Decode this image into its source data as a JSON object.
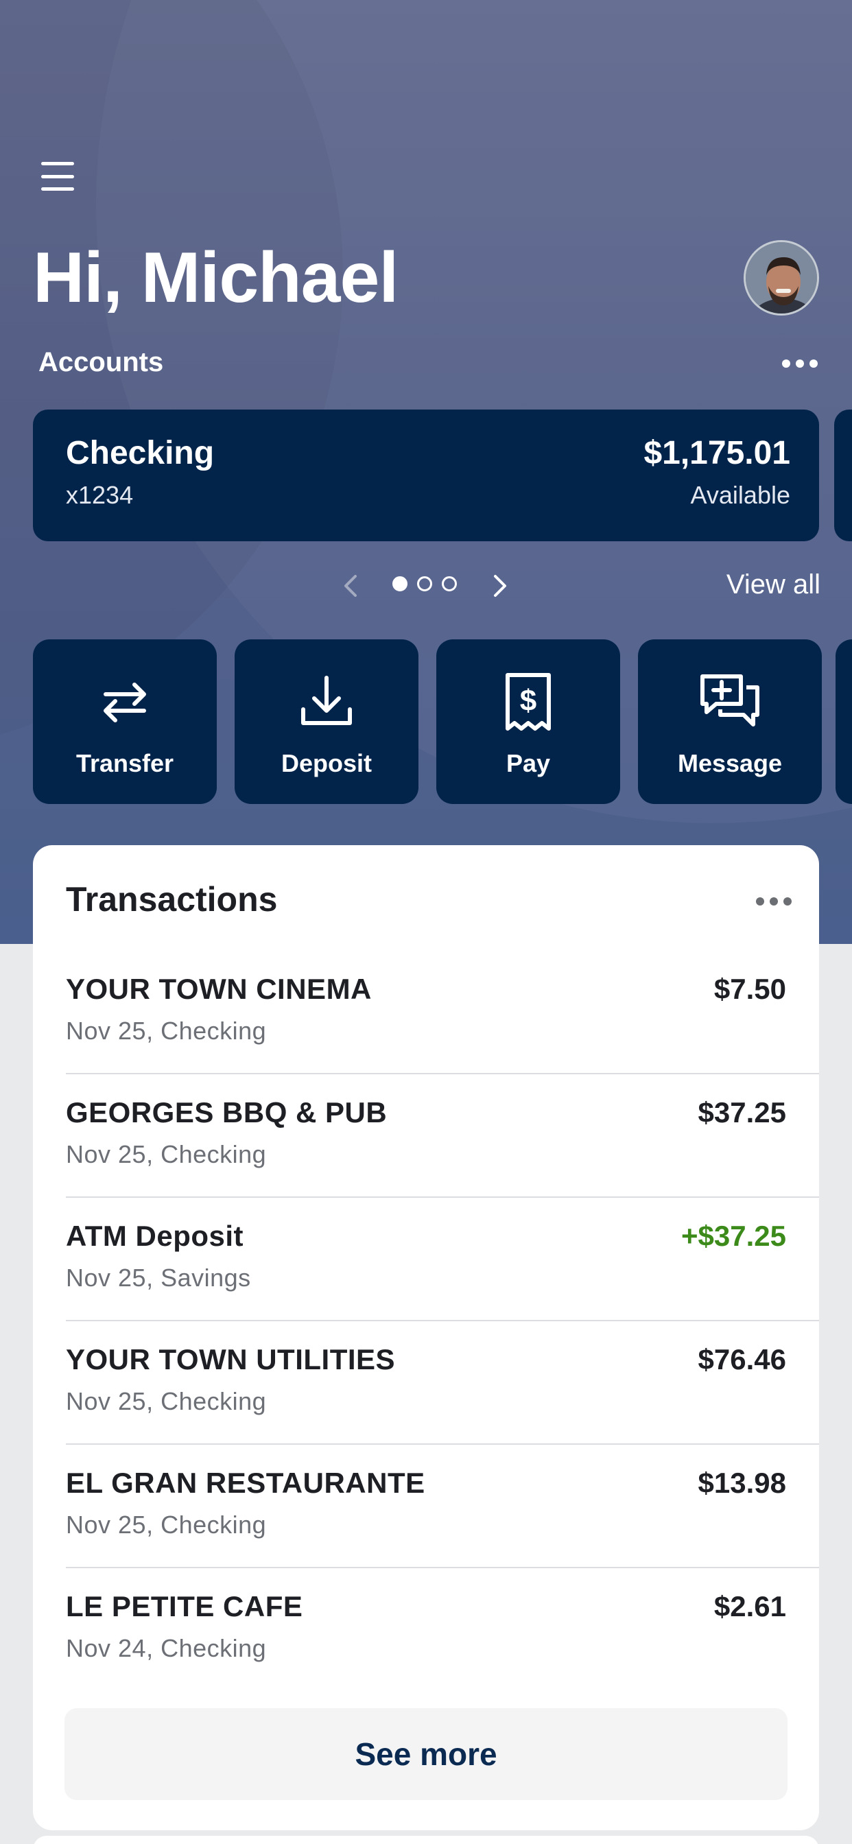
{
  "header": {
    "greeting": "Hi, Michael",
    "accounts_label": "Accounts"
  },
  "account": {
    "name": "Checking",
    "number": "x1234",
    "balance": "$1,175.01",
    "balance_label": "Available"
  },
  "pager": {
    "total": 3,
    "active_index": 0,
    "view_all_label": "View all"
  },
  "actions": [
    {
      "label": "Transfer",
      "icon": "transfer-icon"
    },
    {
      "label": "Deposit",
      "icon": "deposit-icon"
    },
    {
      "label": "Pay",
      "icon": "pay-bill-icon"
    },
    {
      "label": "Message",
      "icon": "message-add-icon"
    }
  ],
  "transactions": {
    "title": "Transactions",
    "items": [
      {
        "merchant": "YOUR TOWN CINEMA",
        "meta": "Nov 25, Checking",
        "amount": "$7.50",
        "credit": false
      },
      {
        "merchant": "GEORGES BBQ & PUB",
        "meta": "Nov 25, Checking",
        "amount": "$37.25",
        "credit": false
      },
      {
        "merchant": "ATM Deposit",
        "meta": "Nov 25, Savings",
        "amount": "+$37.25",
        "credit": true
      },
      {
        "merchant": "YOUR TOWN UTILITIES",
        "meta": "Nov 25, Checking",
        "amount": "$76.46",
        "credit": false
      },
      {
        "merchant": "EL GRAN RESTAURANTE",
        "meta": "Nov 25, Checking",
        "amount": "$13.98",
        "credit": false
      },
      {
        "merchant": "LE PETITE CAFE",
        "meta": "Nov 24, Checking",
        "amount": "$2.61",
        "credit": false
      }
    ],
    "see_more_label": "See more"
  },
  "colors": {
    "navy": "#02244a",
    "credit_green": "#3b8a1a"
  }
}
